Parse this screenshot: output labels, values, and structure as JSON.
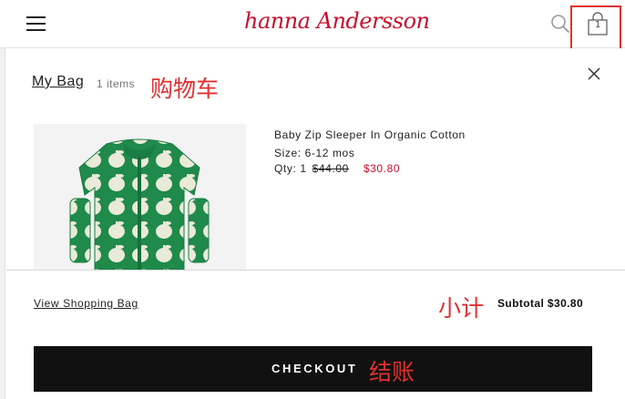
{
  "header": {
    "logo_text": "hanna Andersson",
    "bag_count": "1",
    "brand_color": "#c8102e",
    "icons": [
      "hamburger-menu-icon",
      "search-icon",
      "shopping-bag-icon"
    ]
  },
  "bag": {
    "title": "My Bag",
    "item_count": "1 items",
    "annotation_cart": "购物车",
    "item": {
      "name": "Baby Zip Sleeper In Organic Cotton",
      "size": "Size: 6-12 mos",
      "qty_label": "Qty: 1",
      "original_price": "$44.00",
      "sale_price": "$30.80"
    },
    "view_bag_link": "View Shopping Bag",
    "annotation_subtotal": "小计",
    "subtotal": "Subtotal $30.80",
    "checkout_label": "CHECKOUT",
    "annotation_checkout": "结账"
  },
  "colors": {
    "annotation": "#e03030",
    "sale_price": "#c8102e",
    "checkout_bg": "#111111"
  }
}
